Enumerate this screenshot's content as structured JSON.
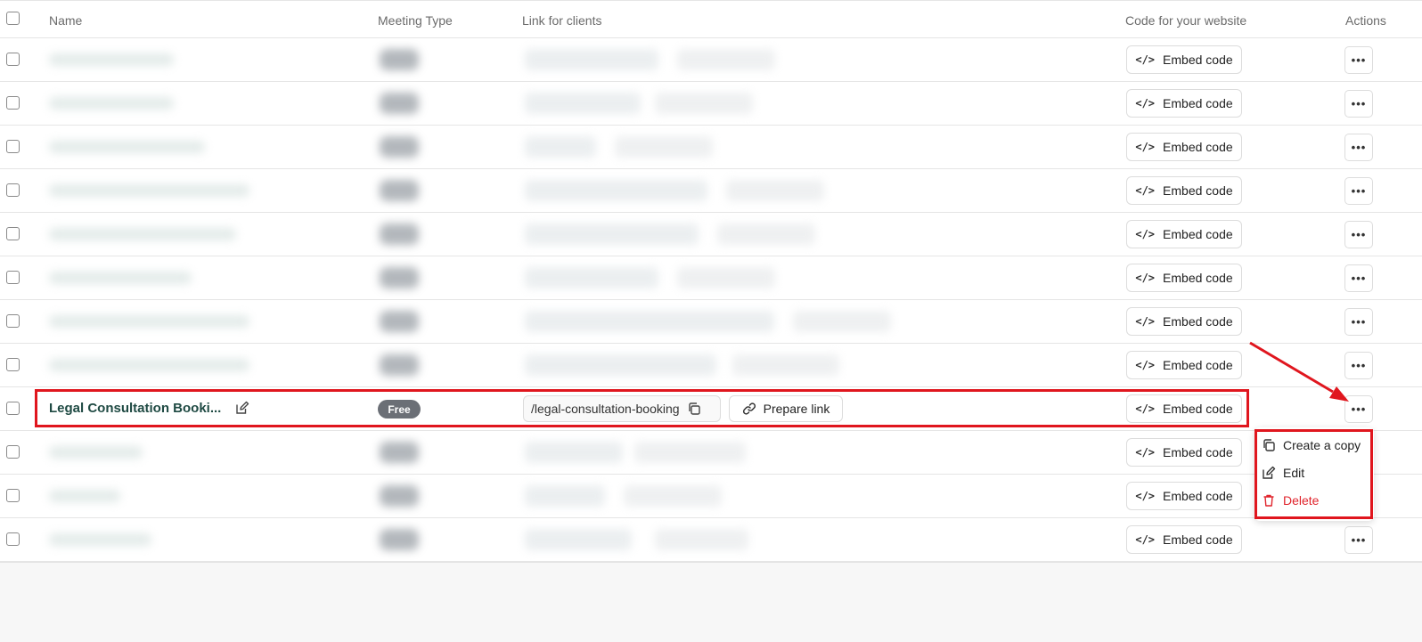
{
  "header": {
    "name": "Name",
    "meeting_type": "Meeting Type",
    "link_for_clients": "Link for clients",
    "code_for_website": "Code for your website",
    "actions": "Actions"
  },
  "embed_label": "Embed code",
  "embed_icon": "</>",
  "more_label": "•••",
  "highlighted_row": {
    "name": "Legal Consultation Booki...",
    "badge": "Free",
    "link": "/legal-consultation-booking",
    "prepare_label": "Prepare link"
  },
  "menu": {
    "create_copy": "Create a copy",
    "edit": "Edit",
    "delete": "Delete"
  },
  "colors": {
    "accent_red": "#e0161e",
    "name_green": "#1f4a43",
    "badge_gray": "#6b6f76"
  }
}
